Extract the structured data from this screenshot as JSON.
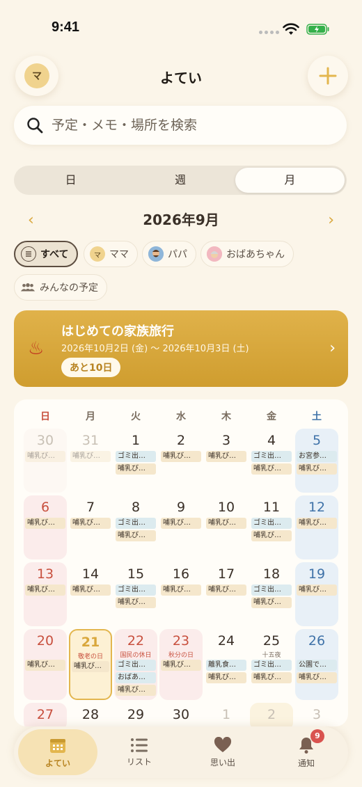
{
  "status": {
    "time": "9:41"
  },
  "header": {
    "avatar_initial": "マ",
    "title": "よてい"
  },
  "search": {
    "placeholder": "予定・メモ・場所を検索"
  },
  "view_tabs": [
    {
      "label": "日"
    },
    {
      "label": "週"
    },
    {
      "label": "月",
      "selected": true
    }
  ],
  "month_label": "2026年9月",
  "filters": [
    {
      "label": "すべて",
      "selected": true
    },
    {
      "label": "ママ",
      "avatar": "マ"
    },
    {
      "label": "パパ"
    },
    {
      "label": "おばあちゃん"
    },
    {
      "label": "みんなの予定"
    }
  ],
  "banner": {
    "title": "はじめての家族旅行",
    "dates": "2026年10月2日 (金) 〜 2026年10月3日 (土)",
    "countdown": "あと10日"
  },
  "weekdays": [
    "日",
    "月",
    "火",
    "水",
    "木",
    "金",
    "土"
  ],
  "weeks": [
    [
      {
        "d": "30",
        "dim": true,
        "ev": [
          {
            "t": "哺乳び…",
            "k": "milk"
          }
        ]
      },
      {
        "d": "31",
        "dim": true,
        "ev": [
          {
            "t": "哺乳び…",
            "k": "milk"
          }
        ]
      },
      {
        "d": "1",
        "ev": [
          {
            "t": "ゴミ出…",
            "k": "garb"
          },
          {
            "t": "哺乳び…",
            "k": "milk"
          }
        ]
      },
      {
        "d": "2",
        "ev": [
          {
            "t": "哺乳び…",
            "k": "milk"
          }
        ]
      },
      {
        "d": "3",
        "ev": [
          {
            "t": "哺乳び…",
            "k": "milk"
          }
        ]
      },
      {
        "d": "4",
        "ev": [
          {
            "t": "ゴミ出…",
            "k": "garb"
          },
          {
            "t": "哺乳び…",
            "k": "milk"
          }
        ]
      },
      {
        "d": "5",
        "ev": [
          {
            "t": "お宮参…",
            "k": "event"
          },
          {
            "t": "哺乳び…",
            "k": "milk"
          }
        ]
      }
    ],
    [
      {
        "d": "6",
        "ev": [
          {
            "t": "哺乳び…",
            "k": "milk"
          }
        ]
      },
      {
        "d": "7",
        "ev": [
          {
            "t": "哺乳び…",
            "k": "milk"
          }
        ]
      },
      {
        "d": "8",
        "ev": [
          {
            "t": "ゴミ出…",
            "k": "garb"
          },
          {
            "t": "哺乳び…",
            "k": "milk"
          }
        ]
      },
      {
        "d": "9",
        "ev": [
          {
            "t": "哺乳び…",
            "k": "milk"
          }
        ]
      },
      {
        "d": "10",
        "ev": [
          {
            "t": "哺乳び…",
            "k": "milk"
          }
        ]
      },
      {
        "d": "11",
        "ev": [
          {
            "t": "ゴミ出…",
            "k": "garb"
          },
          {
            "t": "哺乳び…",
            "k": "milk"
          }
        ]
      },
      {
        "d": "12",
        "ev": [
          {
            "t": "哺乳び…",
            "k": "milk"
          }
        ]
      }
    ],
    [
      {
        "d": "13",
        "ev": [
          {
            "t": "哺乳び…",
            "k": "milk"
          }
        ]
      },
      {
        "d": "14",
        "ev": [
          {
            "t": "哺乳び…",
            "k": "milk"
          }
        ]
      },
      {
        "d": "15",
        "ev": [
          {
            "t": "ゴミ出…",
            "k": "garb"
          },
          {
            "t": "哺乳び…",
            "k": "milk"
          }
        ]
      },
      {
        "d": "16",
        "ev": [
          {
            "t": "哺乳び…",
            "k": "milk"
          }
        ]
      },
      {
        "d": "17",
        "ev": [
          {
            "t": "哺乳び…",
            "k": "milk"
          }
        ]
      },
      {
        "d": "18",
        "ev": [
          {
            "t": "ゴミ出…",
            "k": "garb"
          },
          {
            "t": "哺乳び…",
            "k": "milk"
          }
        ]
      },
      {
        "d": "19",
        "ev": [
          {
            "t": "哺乳び…",
            "k": "milk"
          }
        ]
      }
    ],
    [
      {
        "d": "20",
        "ev": [
          {
            "t": "哺乳び…",
            "k": "milk"
          }
        ]
      },
      {
        "d": "21",
        "today": true,
        "hol": "敬老の日",
        "ev": [
          {
            "t": "哺乳び…",
            "k": "milk"
          }
        ]
      },
      {
        "d": "22",
        "holiday": true,
        "hol": "国民の休日",
        "ev": [
          {
            "t": "ゴミ出…",
            "k": "garb"
          },
          {
            "t": "おばあ…",
            "k": "event"
          },
          {
            "t": "哺乳び…",
            "k": "milk"
          }
        ]
      },
      {
        "d": "23",
        "holiday": true,
        "hol": "秋分の日",
        "ev": [
          {
            "t": "哺乳び…",
            "k": "milk"
          }
        ]
      },
      {
        "d": "24",
        "ev": [
          {
            "t": "離乳食…",
            "k": "event"
          },
          {
            "t": "哺乳び…",
            "k": "milk"
          }
        ]
      },
      {
        "d": "25",
        "hol": "十五夜",
        "holgray": true,
        "ev": [
          {
            "t": "ゴミ出…",
            "k": "garb"
          },
          {
            "t": "哺乳び…",
            "k": "milk"
          }
        ]
      },
      {
        "d": "26",
        "ev": [
          {
            "t": "公園で…",
            "k": "event"
          },
          {
            "t": "哺乳び…",
            "k": "milk"
          }
        ]
      }
    ],
    [
      {
        "d": "27",
        "ev": []
      },
      {
        "d": "28",
        "ev": []
      },
      {
        "d": "29",
        "ev": []
      },
      {
        "d": "30",
        "ev": []
      },
      {
        "d": "1",
        "dim": true,
        "ev": []
      },
      {
        "d": "2",
        "dim": true,
        "trip": true,
        "ev": []
      },
      {
        "d": "3",
        "dim": true,
        "ev": []
      }
    ]
  ],
  "tabbar": [
    {
      "label": "よてい",
      "icon": "calendar-icon",
      "selected": true
    },
    {
      "label": "リスト",
      "icon": "list-icon"
    },
    {
      "label": "思い出",
      "icon": "heart-icon"
    },
    {
      "label": "通知",
      "icon": "bell-icon",
      "badge": "9"
    }
  ],
  "colors": {
    "accent": "#e3b64e",
    "background": "#fbf5e9",
    "sunday": "#c8503e",
    "saturday": "#3f72a8"
  }
}
